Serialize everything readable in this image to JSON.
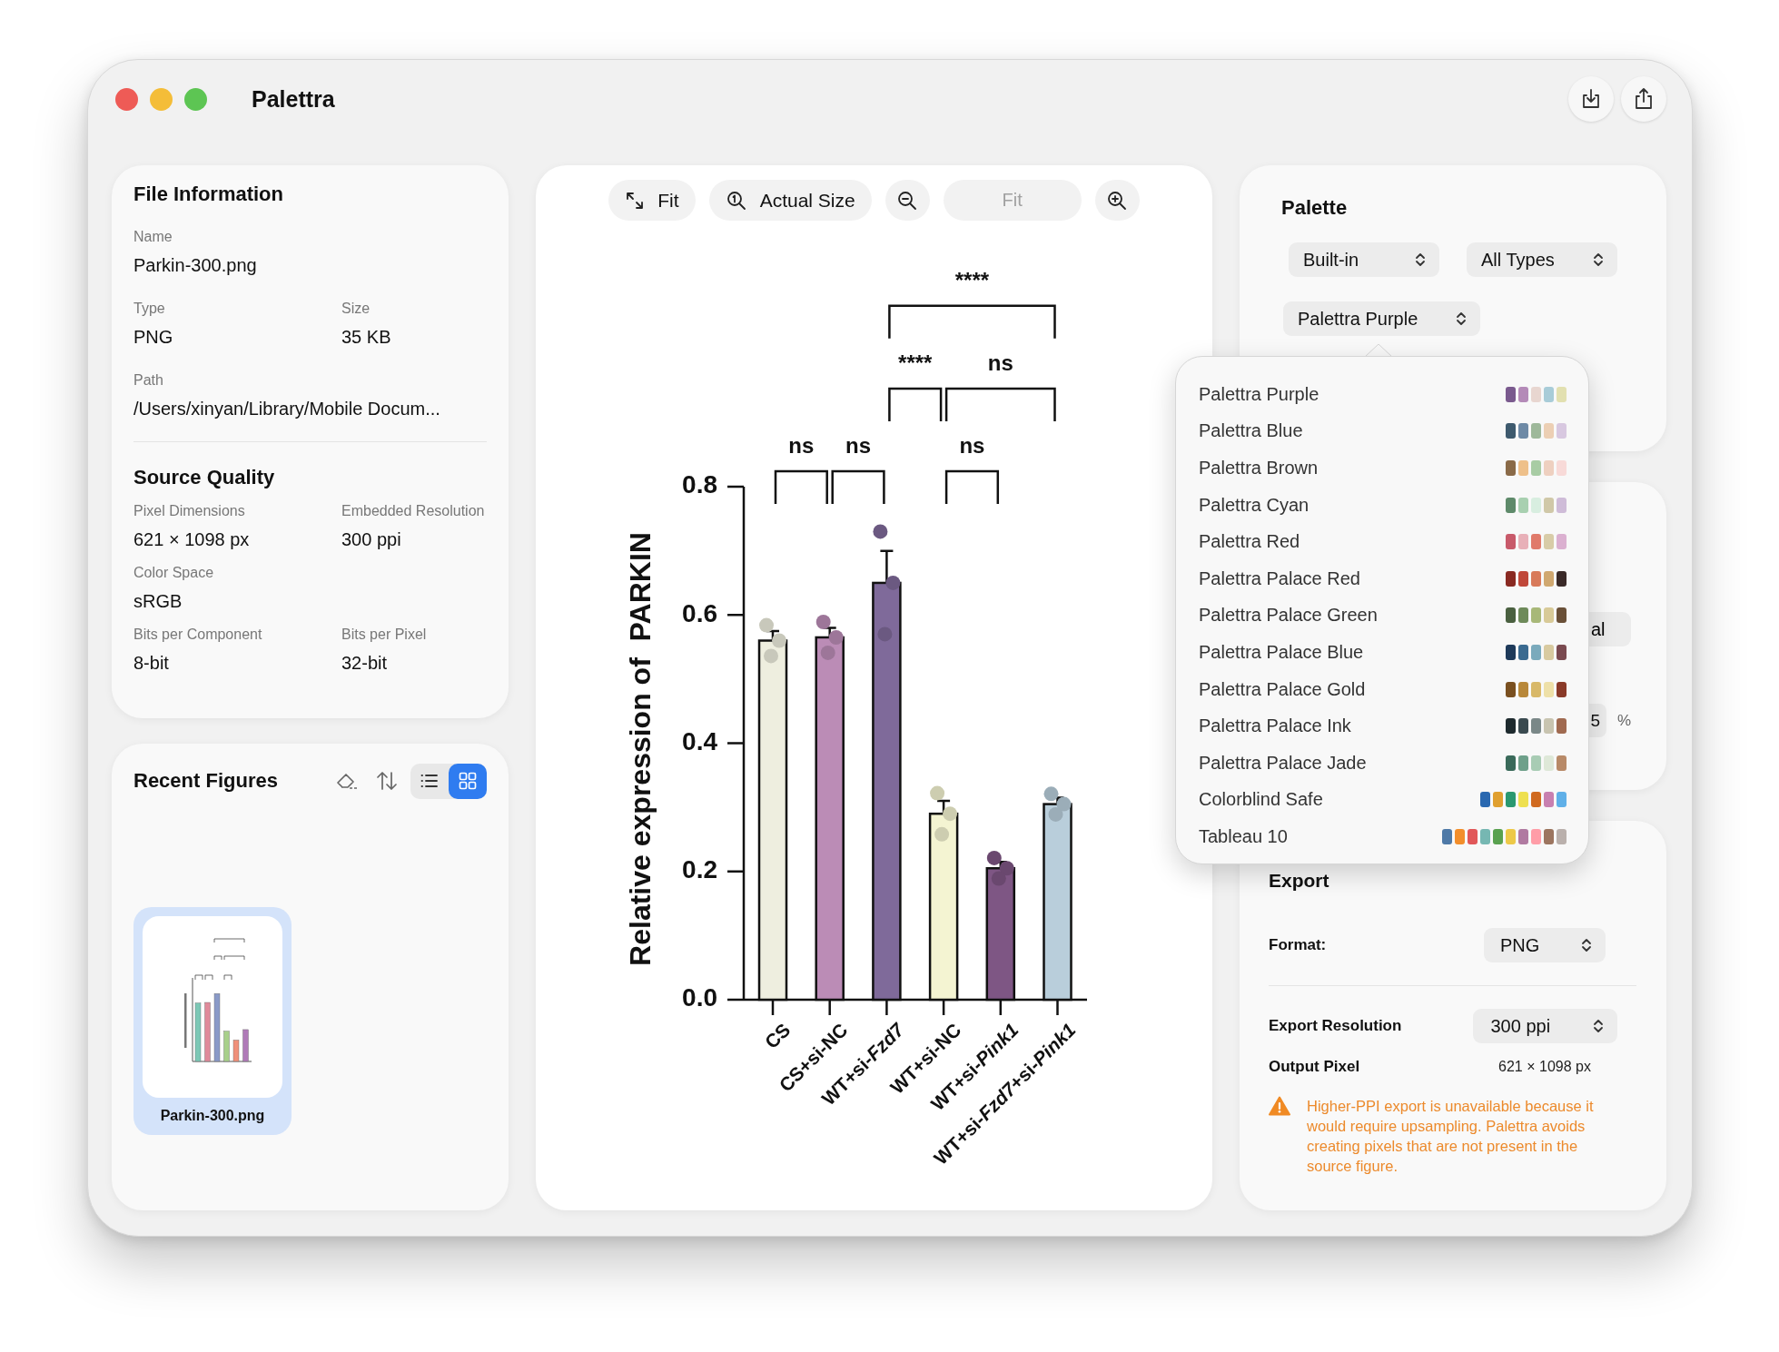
{
  "window": {
    "title": "Palettra"
  },
  "file_information": {
    "title": "File Information",
    "rows": [
      [
        {
          "label": "Name",
          "value": "Parkin-300.png"
        }
      ],
      [
        {
          "label": "Type",
          "value": "PNG"
        },
        {
          "label": "Size",
          "value": "35 KB"
        }
      ],
      [
        {
          "label": "Path",
          "value": "/Users/xinyan/Library/Mobile Docum..."
        }
      ]
    ]
  },
  "source_quality": {
    "title": "Source Quality",
    "rows": [
      [
        {
          "label": "Pixel Dimensions",
          "value": "621 × 1098 px"
        },
        {
          "label": "Embedded Resolution",
          "value": "300 ppi"
        }
      ],
      [
        {
          "label": "Color Space",
          "value": "sRGB"
        }
      ],
      [
        {
          "label": "Bits per Component",
          "value": "8-bit"
        },
        {
          "label": "Bits per Pixel",
          "value": "32-bit"
        }
      ]
    ]
  },
  "recent_figures": {
    "title": "Recent Figures",
    "view_options": [
      {
        "kind": "list",
        "selected": false
      },
      {
        "kind": "grid",
        "selected": true
      }
    ],
    "figures": [
      {
        "name": "Parkin-300.png",
        "selected": true
      }
    ]
  },
  "viewer": {
    "toolbar": {
      "fit_button": "Fit",
      "actual_size_button": "Actual Size",
      "zoom_field": {
        "placeholder": "Fit"
      }
    },
    "chart_data": {
      "type": "bar",
      "ylabel": "Relative expression of  PARKIN",
      "categories": [
        "CS",
        "CS+si-NC",
        "WT+si-*Fzd7*",
        "WT+si-NC",
        "WT+si-*Pink1*",
        "WT+si-*Fzd7*+si-*Pink1*"
      ],
      "values": [
        0.56,
        0.565,
        0.65,
        0.29,
        0.205,
        0.305
      ],
      "errors": [
        0.015,
        0.015,
        0.05,
        0.02,
        0.01,
        0.01
      ],
      "colors": [
        "#eeeedf",
        "#bb8cb6",
        "#7f6a9a",
        "#f4f4d2",
        "#7e5684",
        "#b9cedb"
      ],
      "ylim": [
        0,
        0.8
      ],
      "yticks": [
        {
          "value": 0,
          "label": "0.0"
        },
        {
          "value": 0.2,
          "label": "0.2"
        },
        {
          "value": 0.4,
          "label": "0.4"
        },
        {
          "value": 0.6,
          "label": "0.6"
        },
        {
          "value": 0.8,
          "label": "0.8"
        }
      ],
      "annotations": [
        "ns",
        "ns",
        "ns",
        "****",
        "ns",
        "****"
      ]
    }
  },
  "palette": {
    "title": "Palette",
    "source": "Built-in",
    "type_filter": "All Types",
    "selected_palette": "Palettra Purple",
    "menu": [
      {
        "name": "Palettra Purple",
        "swatches": [
          {
            "color": "#7a5a8e"
          },
          {
            "color": "#b48ab8"
          },
          {
            "color": "#e8d6d0"
          },
          {
            "color": "#a8ccd8"
          },
          {
            "color": "#e2e0b0"
          }
        ]
      },
      {
        "name": "Palettra Blue",
        "swatches": [
          {
            "color": "#3e5a6e"
          },
          {
            "color": "#6e8aa6"
          },
          {
            "color": "#9eb89a"
          },
          {
            "color": "#eccfb4"
          },
          {
            "color": "#d8c8e0"
          }
        ]
      },
      {
        "name": "Palettra Brown",
        "swatches": [
          {
            "color": "#8a6a48"
          },
          {
            "color": "#eec08a"
          },
          {
            "color": "#a8cca4"
          },
          {
            "color": "#eed0c0"
          },
          {
            "color": "#f8dad8"
          }
        ]
      },
      {
        "name": "Palettra Cyan",
        "swatches": [
          {
            "color": "#5e8a6a"
          },
          {
            "color": "#a8d0b0"
          },
          {
            "color": "#d8eee0"
          },
          {
            "color": "#d0c8a8"
          },
          {
            "color": "#cfbcd8"
          }
        ]
      },
      {
        "name": "Palettra Red",
        "swatches": [
          {
            "color": "#c85a6a"
          },
          {
            "color": "#e8b0b8"
          },
          {
            "color": "#e07a6a"
          },
          {
            "color": "#d8cca8"
          },
          {
            "color": "#dbb0d0"
          }
        ]
      },
      {
        "name": "Palettra Palace Red",
        "swatches": [
          {
            "color": "#8a2a22"
          },
          {
            "color": "#c0483a"
          },
          {
            "color": "#d87a5a"
          },
          {
            "color": "#d0a870"
          },
          {
            "color": "#3a2a28"
          }
        ]
      },
      {
        "name": "Palettra Palace Green",
        "swatches": [
          {
            "color": "#4a6040"
          },
          {
            "color": "#6e8a5a"
          },
          {
            "color": "#a8b878"
          },
          {
            "color": "#d8ca98"
          },
          {
            "color": "#6a5038"
          }
        ]
      },
      {
        "name": "Palettra Palace Blue",
        "swatches": [
          {
            "color": "#1e3a5a"
          },
          {
            "color": "#3a6a90"
          },
          {
            "color": "#7aaabc"
          },
          {
            "color": "#d8caa0"
          },
          {
            "color": "#7a4a50"
          }
        ]
      },
      {
        "name": "Palettra Palace Gold",
        "swatches": [
          {
            "color": "#7a5020"
          },
          {
            "color": "#b8883a"
          },
          {
            "color": "#d8b868"
          },
          {
            "color": "#eee0a8"
          },
          {
            "color": "#8a3a28"
          }
        ]
      },
      {
        "name": "Palettra Palace Ink",
        "swatches": [
          {
            "color": "#1e2a2e"
          },
          {
            "color": "#3a4a50"
          },
          {
            "color": "#7a8888"
          },
          {
            "color": "#c8c4b0"
          },
          {
            "color": "#a06a50"
          }
        ]
      },
      {
        "name": "Palettra Palace Jade",
        "swatches": [
          {
            "color": "#3a6a5a"
          },
          {
            "color": "#6ea08a"
          },
          {
            "color": "#a8ccb4"
          },
          {
            "color": "#dee8d8"
          },
          {
            "color": "#b88a68"
          }
        ]
      },
      {
        "name": "Colorblind Safe",
        "swatches": [
          {
            "color": "#2a68b0"
          },
          {
            "color": "#e0a030"
          },
          {
            "color": "#2a9870"
          },
          {
            "color": "#eee050"
          },
          {
            "color": "#d06a20"
          },
          {
            "color": "#c880b0"
          },
          {
            "color": "#60b0e8"
          }
        ]
      },
      {
        "name": "Tableau 10",
        "swatches": [
          {
            "color": "#4e79a7"
          },
          {
            "color": "#f28e2b"
          },
          {
            "color": "#e15759"
          },
          {
            "color": "#76b7b2"
          },
          {
            "color": "#59a14f"
          },
          {
            "color": "#edc948"
          },
          {
            "color": "#b07aa1"
          },
          {
            "color": "#ff9da7"
          },
          {
            "color": "#9c755f"
          },
          {
            "color": "#bab0ac"
          }
        ]
      }
    ]
  },
  "adjust": {
    "button": "al",
    "field_value": "5",
    "unit": "%"
  },
  "export": {
    "title": "Export",
    "format_label": "Format:",
    "format": "PNG",
    "resolution_label": "Export Resolution",
    "resolution": "300 ppi",
    "output_label": "Output Pixel",
    "output_value": "621 × 1098 px",
    "warning": "Higher-PPI export is unavailable because it would require upsampling. Palettra avoids creating pixels that are not present in the source figure."
  }
}
